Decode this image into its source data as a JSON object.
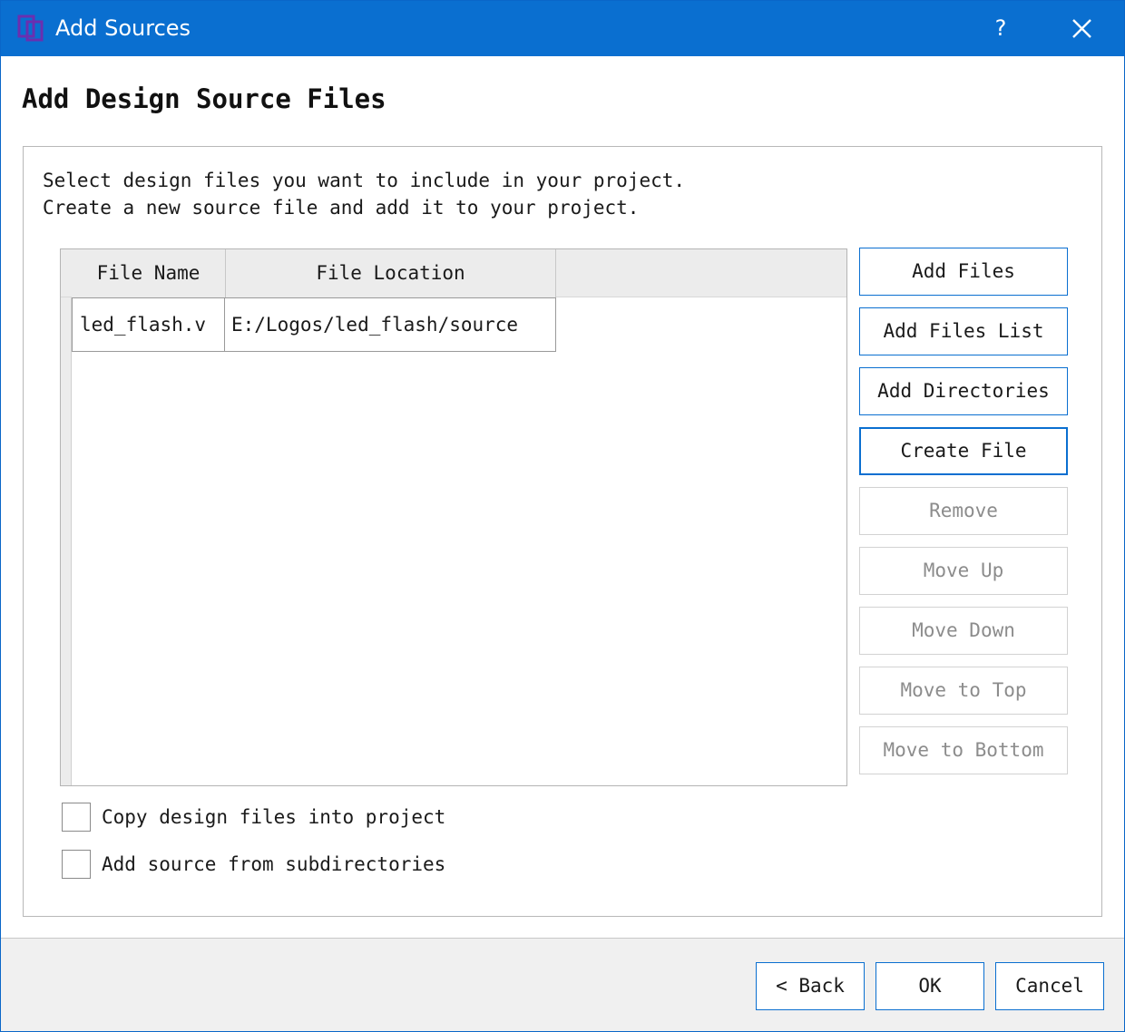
{
  "window": {
    "title": "Add Sources",
    "help_label": "?",
    "icon": "app-logo-icon",
    "accent_color": "#0a6fd0"
  },
  "page": {
    "title": "Add Design Source Files",
    "description_line1": "Select design files you want to include in your project.",
    "description_line2": "Create a new source file and add it to your project."
  },
  "table": {
    "columns": [
      "File Name",
      "File Location"
    ],
    "rows": [
      {
        "name": "led_flash.v",
        "location": "E:/Logos/led_flash/source"
      }
    ]
  },
  "side_buttons": [
    {
      "label": "Add Files",
      "state": "enabled"
    },
    {
      "label": "Add Files List",
      "state": "enabled"
    },
    {
      "label": "Add Directories",
      "state": "enabled"
    },
    {
      "label": "Create File",
      "state": "focused"
    },
    {
      "label": "Remove",
      "state": "disabled"
    },
    {
      "label": "Move Up",
      "state": "disabled"
    },
    {
      "label": "Move Down",
      "state": "disabled"
    },
    {
      "label": "Move to Top",
      "state": "disabled"
    },
    {
      "label": "Move to Bottom",
      "state": "disabled"
    }
  ],
  "options": {
    "copy_files": {
      "label": "Copy design files into project",
      "checked": false
    },
    "subdirectories": {
      "label": "Add source from subdirectories",
      "checked": false
    }
  },
  "footer": {
    "back_label": "< Back",
    "ok_label": "OK",
    "cancel_label": "Cancel"
  }
}
